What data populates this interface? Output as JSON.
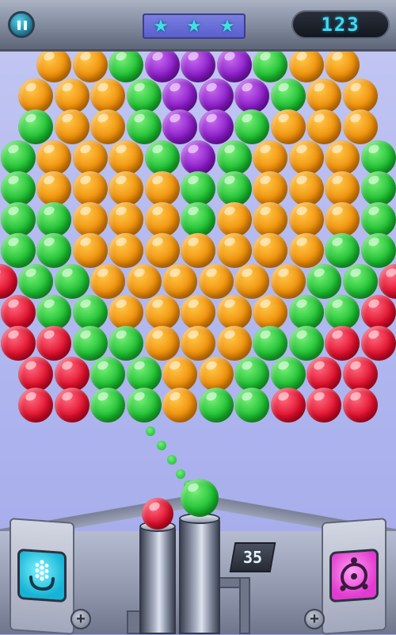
{
  "hud": {
    "pause_icon": "pause-icon",
    "stars": [
      "star-icon",
      "star-icon",
      "star-icon"
    ],
    "stars_earned": 3,
    "score": "123"
  },
  "shots_left": "35",
  "bubble_colors": {
    "O": "#f0900a",
    "P": "#8a1cc8",
    "G": "#1ec032",
    "R": "#e0102c"
  },
  "board": [
    "OOGPPPGOO",
    "OOOGPPPGOO",
    "GOOGPPGOOO",
    "GOOOGPGOOOG",
    "GOOOOGGOOOG",
    "GGOOOGOOOOG",
    "GGOOOOOOOGG",
    "RGGOOOOOOGGR",
    "RGGOOOOOGGR",
    "RRGGOOOGGRR",
    "RRGGOOGGRR",
    "RRGGOGGRRR"
  ],
  "next_bubble": "R",
  "current_bubble": "G",
  "powerups": {
    "left_icon": "microphone-icon",
    "right_icon": "target-icon"
  }
}
